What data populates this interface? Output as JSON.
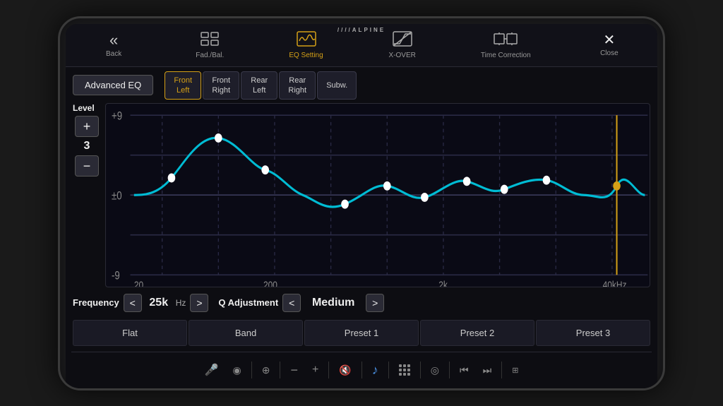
{
  "brand": "////ALPINE",
  "nav": {
    "items": [
      {
        "id": "back",
        "label": "Back",
        "icon": "«",
        "active": false
      },
      {
        "id": "fad-bal",
        "label": "Fad./Bal.",
        "icon": "⊞",
        "active": false
      },
      {
        "id": "eq-setting",
        "label": "EQ Setting",
        "icon": "〜",
        "active": true
      },
      {
        "id": "x-over",
        "label": "X-OVER",
        "icon": "⧄",
        "active": false
      },
      {
        "id": "time-correction",
        "label": "Time Correction",
        "icon": "⊡",
        "active": false
      },
      {
        "id": "close",
        "label": "Close",
        "icon": "✕",
        "active": false
      }
    ]
  },
  "advanced_eq_label": "Advanced EQ",
  "channels": [
    {
      "id": "front-left",
      "label": "Front\nLeft",
      "active": true
    },
    {
      "id": "front-right",
      "label": "Front\nRight",
      "active": false
    },
    {
      "id": "rear-left",
      "label": "Rear\nLeft",
      "active": false
    },
    {
      "id": "rear-right",
      "label": "Rear\nRight",
      "active": false
    },
    {
      "id": "subw",
      "label": "Subw.",
      "active": false
    }
  ],
  "level": {
    "label": "Level",
    "value": "3",
    "plus_label": "+",
    "minus_label": "−"
  },
  "eq_graph": {
    "y_labels": [
      "+9",
      "±0",
      "-9"
    ],
    "x_labels": [
      "20",
      "200",
      "2k",
      "40kHz"
    ]
  },
  "frequency": {
    "label": "Frequency",
    "value": "25k",
    "unit": "Hz",
    "prev_label": "<",
    "next_label": ">"
  },
  "q_adjustment": {
    "label": "Q Adjustment",
    "value": "Medium",
    "prev_label": "<",
    "next_label": ">"
  },
  "presets": [
    {
      "id": "flat",
      "label": "Flat"
    },
    {
      "id": "band",
      "label": "Band"
    },
    {
      "id": "preset1",
      "label": "Preset 1"
    },
    {
      "id": "preset2",
      "label": "Preset 2"
    },
    {
      "id": "preset3",
      "label": "Preset 3"
    }
  ],
  "bottom_bar": {
    "mic_icon": "🎤",
    "nav_icon": "⊕",
    "minus_icon": "−",
    "plus_icon": "+",
    "mute_icon": "🔇",
    "music_icon": "♪",
    "grid_icon": "⊞",
    "camera_icon": "◉",
    "prev_icon": "⏮",
    "next_icon": "⏭"
  }
}
